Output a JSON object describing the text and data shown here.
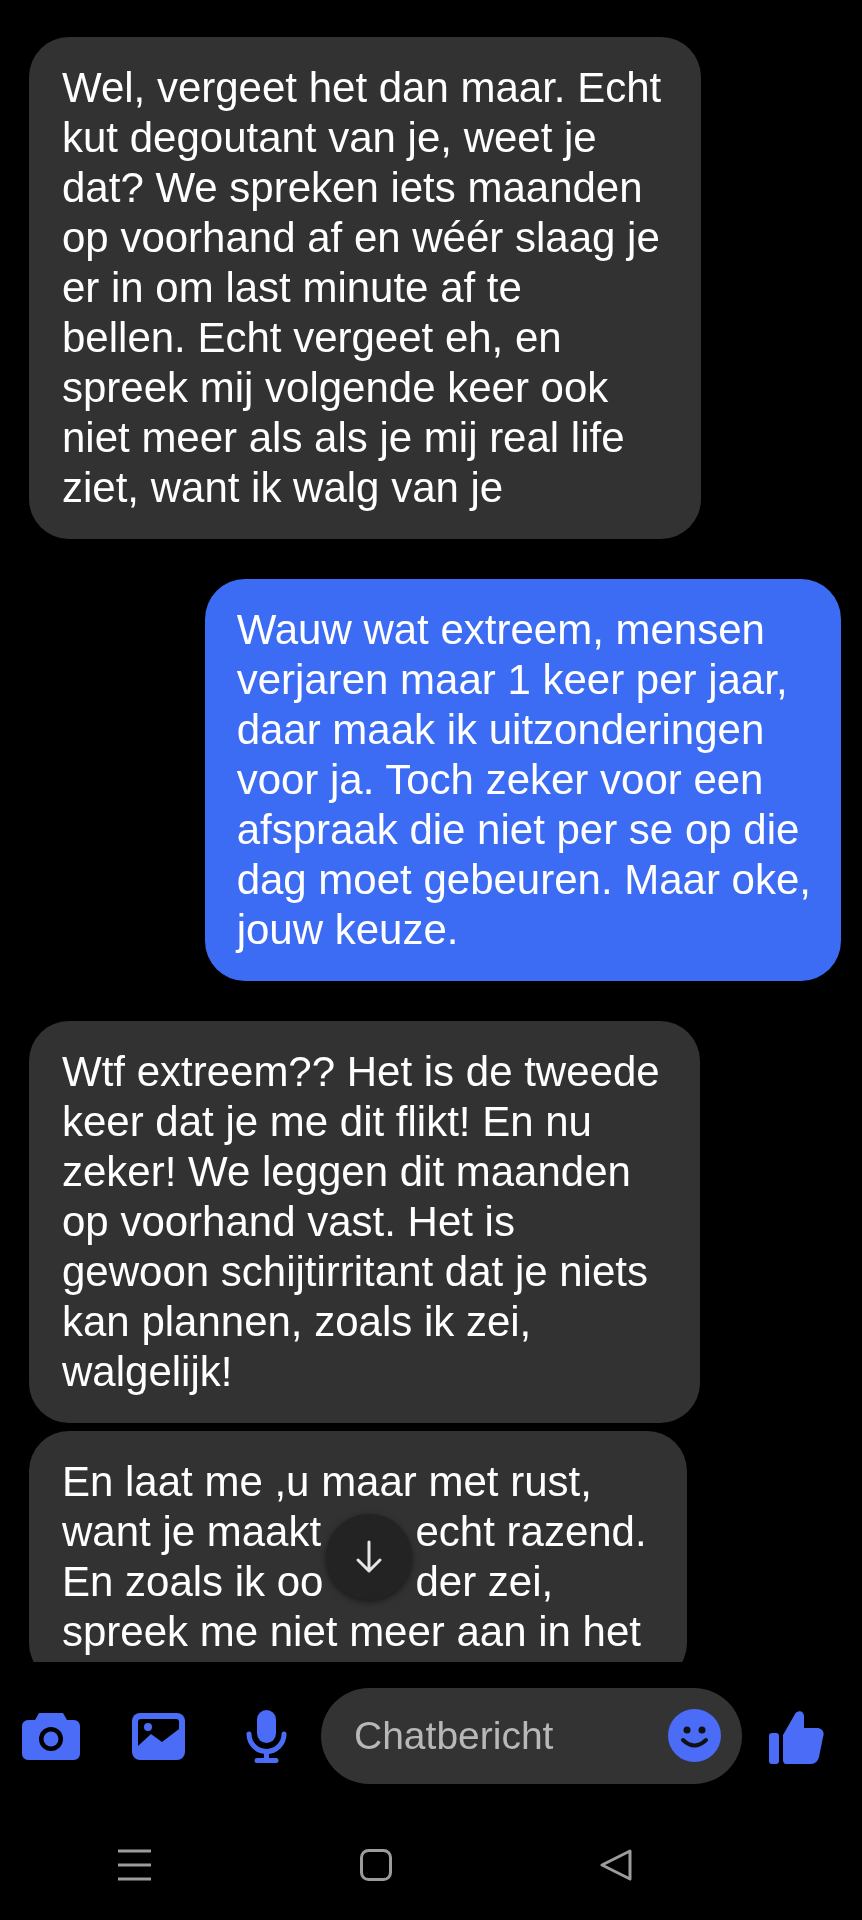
{
  "messages": [
    {
      "kind": "received",
      "text": "Wel, vergeet het dan maar. Echt\nkut degoutant van je, weet je\ndat? We spreken iets maanden\nop voorhand af en wéér slaag je\ner in om last minute af te\nbellen. Echt vergeet eh, en\nspreek mij volgende keer ook\nniet meer als als je mij real life\nziet, want ik walg van je"
    },
    {
      "kind": "sent",
      "text": "Wauw wat extreem, mensen\nverjaren maar 1 keer per jaar,\ndaar maak ik uitzonderingen\nvoor ja. Toch zeker voor een\nafspraak die niet per se op die\ndag moet gebeuren. Maar oke,\njouw keuze."
    },
    {
      "kind": "received",
      "text": "Wtf extreem?? Het is de tweede\nkeer dat je me dit flikt! En nu\nzeker! We leggen dit maanden\nop voorhand vast. Het is\ngewoon schijtirritant dat je niets\nkan plannen, zoals ik zei,\nwalgelijk!"
    },
    {
      "kind": "received",
      "lines": [
        [
          "En laat me ,u maar met rust,"
        ],
        [
          "want je maakt",
          "echt razend."
        ],
        [
          "En zoals ik oo",
          "der zei,"
        ],
        [
          "spreek me niet meer aan in het"
        ]
      ]
    }
  ],
  "composer": {
    "placeholder": "Chatbericht"
  }
}
